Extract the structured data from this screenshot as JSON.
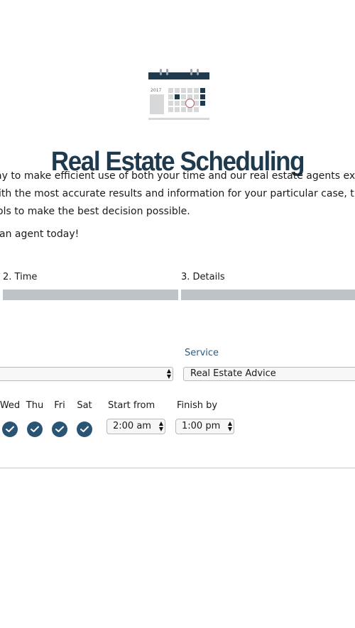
{
  "header": {
    "calendar_year": "2017",
    "title": "Real Estate Scheduling"
  },
  "intro": {
    "line1": "ay to make efficient use of both your time and our real estate agents exper",
    "line2": "ith the most accurate results and information for your particular case, thu",
    "line3": "ols to make the best decision possible.",
    "cta": "an agent today!"
  },
  "steps": [
    {
      "label": "2. Time"
    },
    {
      "label": "3. Details"
    }
  ],
  "form": {
    "location_select_value": "",
    "service_label": "Service",
    "service_select_value": "Real Estate Advice",
    "days": [
      {
        "label": "Wed",
        "checked": true
      },
      {
        "label": "Thu",
        "checked": true
      },
      {
        "label": "Fri",
        "checked": true
      },
      {
        "label": "Sat",
        "checked": true
      }
    ],
    "start_from_label": "Start from",
    "start_from_value": "2:00 am",
    "finish_by_label": "Finish by",
    "finish_by_value": "1:00 pm"
  },
  "colors": {
    "title": "#1e3a4c",
    "accent": "#2a5474",
    "service_label": "#2d5d80",
    "progress_bar": "#bfc3c6"
  }
}
